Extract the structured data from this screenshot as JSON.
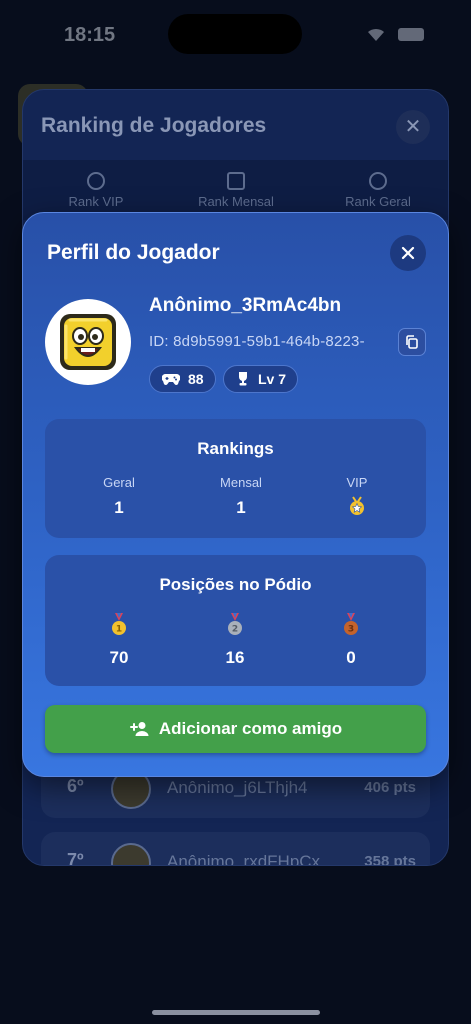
{
  "status_bar": {
    "time": "18:15"
  },
  "background_modal": {
    "title": "Ranking de Jogadores",
    "tabs": [
      "Rank VIP",
      "Rank Mensal",
      "Rank Geral"
    ],
    "rows": [
      {
        "rank": "6º",
        "name": "Anônimo_j6LThjh4",
        "points": "406 pts"
      },
      {
        "rank": "7º",
        "name": "Anônimo_rxdFHpCx",
        "points": "358 pts"
      }
    ]
  },
  "profile": {
    "title": "Perfil do Jogador",
    "name": "Anônimo_3RmAc4bn",
    "id": "ID: 8d9b5991-59b1-464b-8223-",
    "games": "88",
    "level": "Lv 7",
    "rankings": {
      "title": "Rankings",
      "geral_label": "Geral",
      "geral_value": "1",
      "mensal_label": "Mensal",
      "mensal_value": "1",
      "vip_label": "VIP"
    },
    "podium": {
      "title": "Posições no Pódio",
      "gold": "70",
      "silver": "16",
      "bronze": "0"
    },
    "add_friend_label": "Adicionar como amigo"
  },
  "colors": {
    "modal_top": "#2850a8",
    "modal_bottom": "#3876e0",
    "add_button": "#43a04a",
    "gold": "#f2c12e",
    "silver": "#a9b0ba",
    "bronze": "#c4632c"
  },
  "icons": [
    "close-icon",
    "copy-icon",
    "gamepad-icon",
    "trophy-icon",
    "vip-medal-icon",
    "gold-medal-icon",
    "silver-medal-icon",
    "bronze-medal-icon",
    "add-person-icon"
  ]
}
